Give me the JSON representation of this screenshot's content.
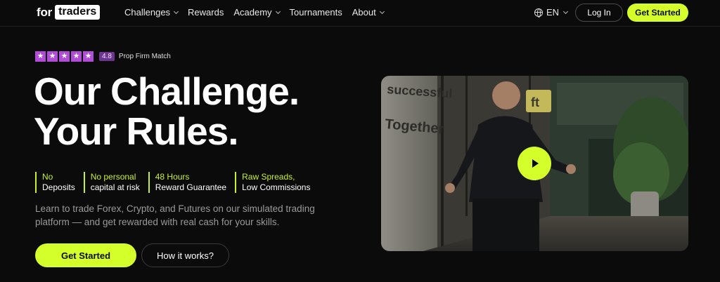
{
  "brand": {
    "logo_prefix": "for",
    "logo_box": "traders"
  },
  "nav": {
    "items": [
      {
        "label": "Challenges",
        "has_dropdown": true
      },
      {
        "label": "Rewards",
        "has_dropdown": false
      },
      {
        "label": "Academy",
        "has_dropdown": true
      },
      {
        "label": "Tournaments",
        "has_dropdown": false
      },
      {
        "label": "About",
        "has_dropdown": true
      }
    ],
    "language": "EN",
    "login_label": "Log In",
    "get_started_label": "Get Started"
  },
  "rating": {
    "stars": 5,
    "score": "4.8",
    "source": "Prop Firm Match"
  },
  "hero": {
    "headline_line1": "Our Challenge.",
    "headline_line2": "Your Rules.",
    "features": [
      {
        "line1": "No",
        "line2": "Deposits"
      },
      {
        "line1": "No personal",
        "line2": "capital at risk"
      },
      {
        "line1": "48 Hours",
        "line2": "Reward Guarantee"
      },
      {
        "line1": "Raw Spreads,",
        "line2": "Low Commissions"
      }
    ],
    "description": "Learn to trade Forex, Crypto, and Futures on our simulated trading platform — and get rewarded with real cash for your skills.",
    "primary_cta": "Get Started",
    "secondary_cta": "How it works?"
  },
  "video": {
    "wall_text_1": "successful",
    "wall_text_2": "Together",
    "sign_text": "ft"
  },
  "colors": {
    "accent": "#d4ff2a",
    "background": "#0b0b0b",
    "star": "#b04dd8"
  }
}
